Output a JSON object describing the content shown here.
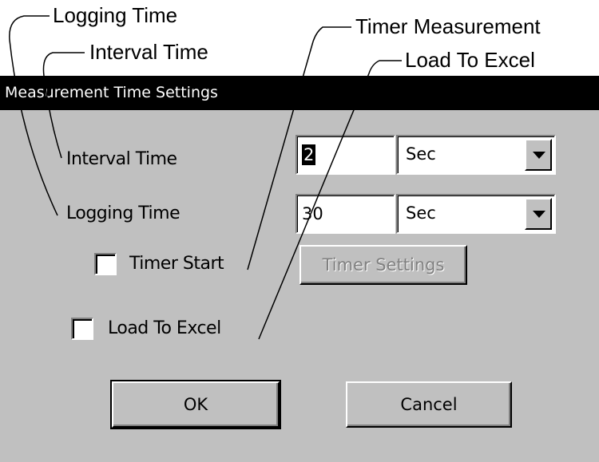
{
  "callouts": {
    "logging_time": "Logging Time",
    "interval_time": "Interval Time",
    "timer_measurement": "Timer Measurement",
    "load_to_excel": "Load To Excel"
  },
  "dialog": {
    "title": "Measurement Time Settings",
    "interval": {
      "label": "Interval Time",
      "value": "2",
      "unit": "Sec"
    },
    "logging": {
      "label": "Logging Time",
      "value": "30",
      "unit": "Sec"
    },
    "timer_start": {
      "label": "Timer Start",
      "checked": false
    },
    "timer_settings_label": "Timer Settings",
    "load_to_excel": {
      "label": "Load To Excel",
      "checked": false
    },
    "ok_label": "OK",
    "cancel_label": "Cancel"
  },
  "colors": {
    "dialog_bg": "#c0c0c0",
    "titlebar_bg": "#000000",
    "titlebar_text": "#ffffff",
    "disabled_text": "#808080"
  },
  "icons": {
    "combo_arrow": "chevron-down-icon"
  }
}
